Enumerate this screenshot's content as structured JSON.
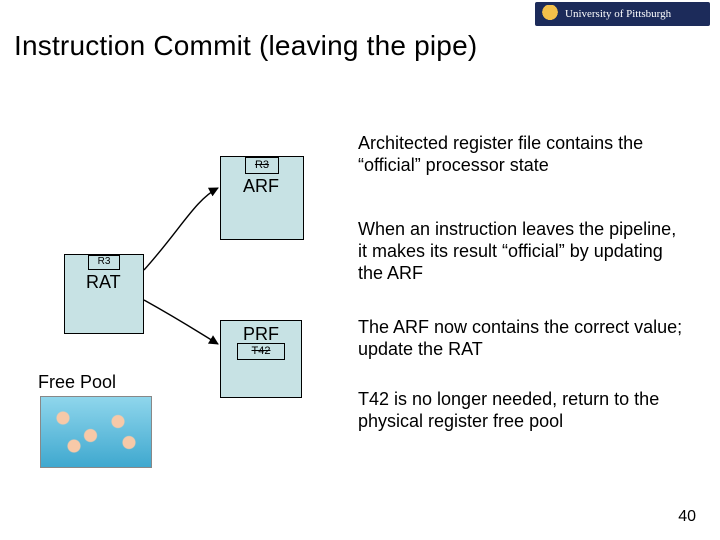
{
  "brand": "University of Pittsburgh",
  "title": "Instruction Commit (leaving the pipe)",
  "arf": {
    "head": "R3",
    "label": "ARF"
  },
  "rat": {
    "head": "R3",
    "label": "RAT"
  },
  "prf": {
    "label": "PRF",
    "cell": "T42"
  },
  "free_pool_label": "Free Pool",
  "paragraphs": {
    "p1": "Architected register file contains the “official” processor state",
    "p2": "When an instruction leaves the pipeline, it makes its result “official” by updating the ARF",
    "p3": "The ARF now contains the correct value; update the RAT",
    "p4": "T42 is no longer needed, return to the physical register free pool"
  },
  "page_number": "40"
}
